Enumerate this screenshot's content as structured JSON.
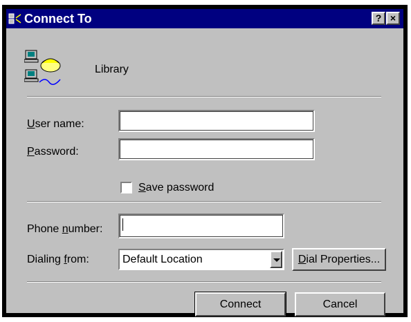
{
  "window": {
    "title": "Connect To",
    "help_glyph": "?",
    "close_glyph": "×"
  },
  "entry": {
    "name": "Library"
  },
  "form": {
    "username": {
      "label_key": "U",
      "label_rest": "ser name:",
      "value": ""
    },
    "password": {
      "label_key": "P",
      "label_rest": "assword:",
      "value": ""
    },
    "save_password": {
      "label_key": "S",
      "label_rest": "ave password",
      "checked": false
    },
    "phone": {
      "label_pre": "Phone ",
      "label_key": "n",
      "label_rest": "umber:",
      "value": ""
    },
    "dialing": {
      "label_pre": "Dialing ",
      "label_key": "f",
      "label_rest": "rom:",
      "value": "Default Location"
    }
  },
  "buttons": {
    "dial_properties_key": "D",
    "dial_properties_rest": "ial Properties...",
    "connect": "Connect",
    "cancel": "Cancel"
  },
  "colors": {
    "titlebar": "#000080",
    "face": "#c0c0c0"
  }
}
